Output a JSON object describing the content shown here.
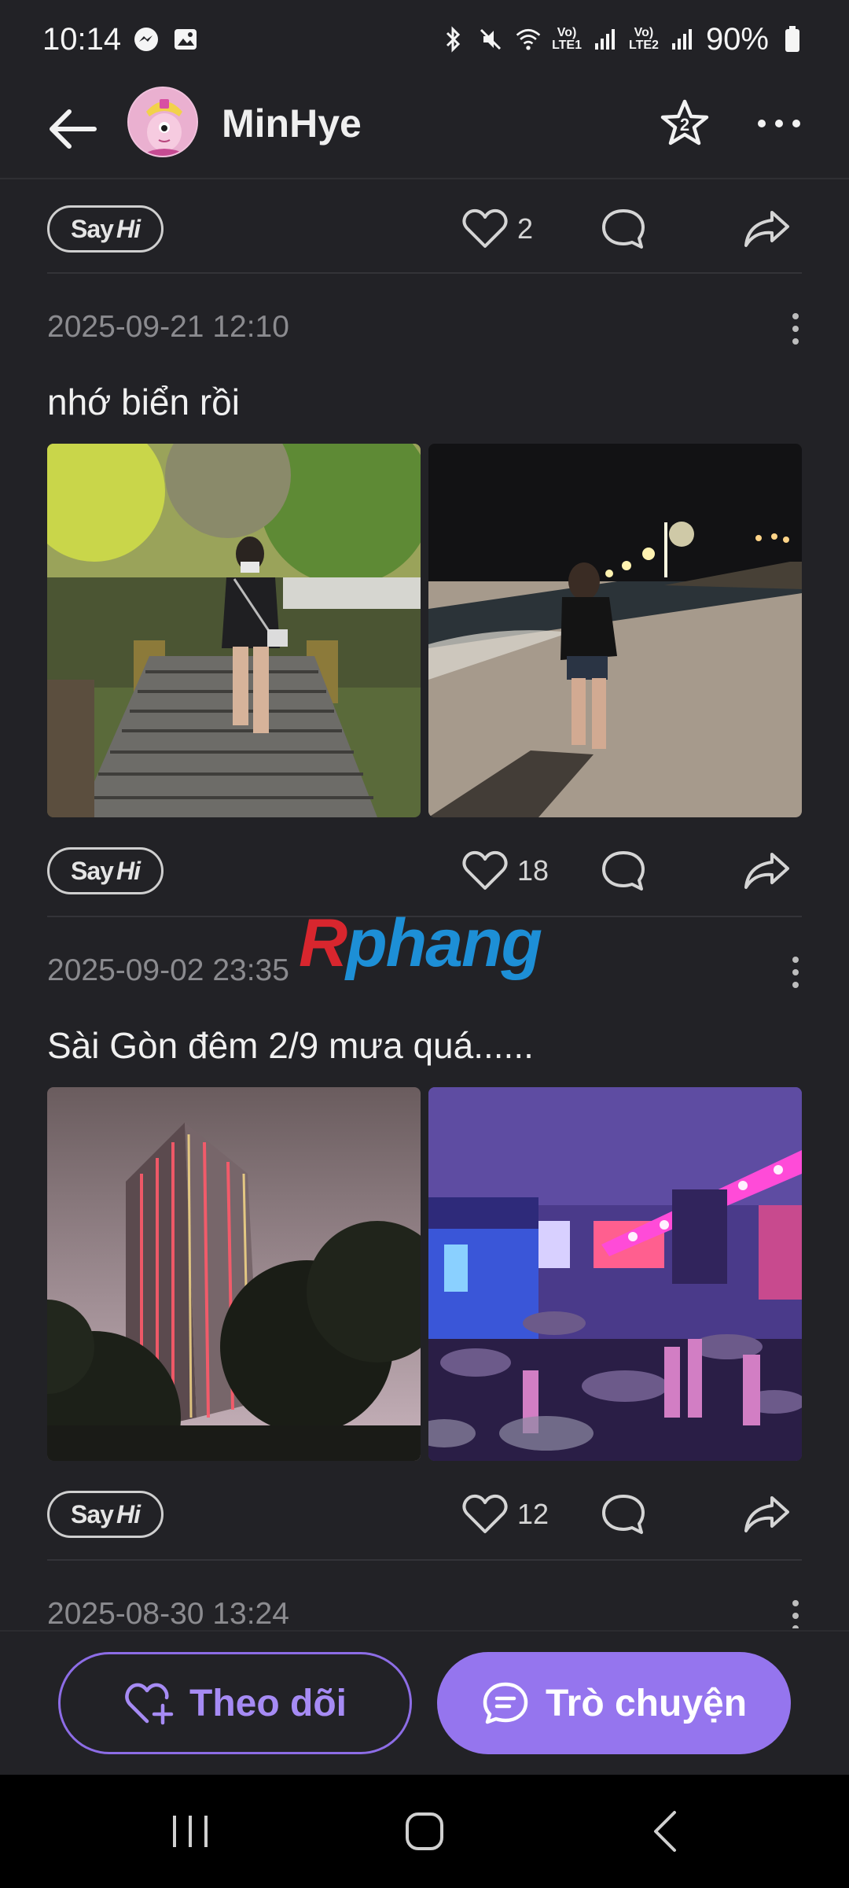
{
  "status_bar": {
    "time": "10:14",
    "lte1": "LTE1",
    "lte2": "LTE2",
    "volte": "Vo)",
    "battery": "90%"
  },
  "header": {
    "username": "MinHye",
    "star_badge": "2"
  },
  "say_hi": {
    "say": "Say",
    "hi": "Hi"
  },
  "top_action_row": {
    "likes": "2"
  },
  "posts": [
    {
      "date": "2025-09-21 12:10",
      "text": "nhớ biển rồi",
      "likes": "18",
      "photos": [
        "stairs-photo",
        "beach-night-photo"
      ]
    },
    {
      "date": "2025-09-02 23:35",
      "text": "Sài Gòn đêm 2/9 mưa quá......",
      "likes": "12",
      "photos": [
        "city-tower-photo",
        "concert-rain-photo"
      ]
    },
    {
      "date": "2025-08-30 13:24"
    }
  ],
  "watermark": {
    "first": "R",
    "rest": "phang"
  },
  "bottom": {
    "follow_label": "Theo dõi",
    "chat_label": "Trò chuyện"
  },
  "colors": {
    "background": "#222226",
    "accent": "#9575ee",
    "accent_text": "#a68bf4"
  },
  "icons": [
    "back-arrow-icon",
    "star-icon",
    "more-icon",
    "heart-icon",
    "comment-icon",
    "share-icon",
    "heart-plus-icon",
    "chat-icon"
  ]
}
